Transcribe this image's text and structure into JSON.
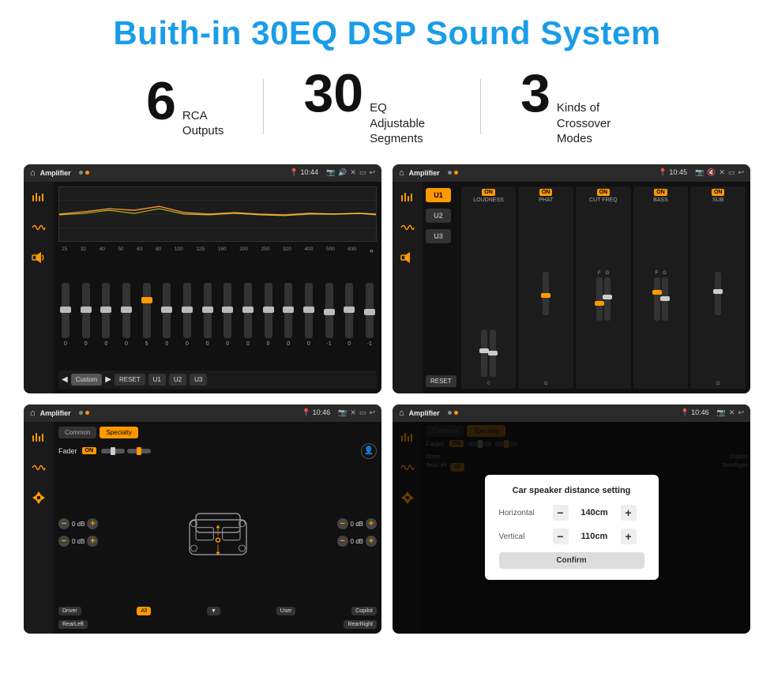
{
  "title": "Buith-in 30EQ DSP Sound System",
  "stats": [
    {
      "number": "6",
      "desc_line1": "RCA",
      "desc_line2": "Outputs"
    },
    {
      "number": "30",
      "desc_line1": "EQ Adjustable",
      "desc_line2": "Segments"
    },
    {
      "number": "3",
      "desc_line1": "Kinds of",
      "desc_line2": "Crossover Modes"
    }
  ],
  "screens": [
    {
      "id": "eq-screen",
      "topbar": {
        "title": "Amplifier",
        "time": "10:44"
      },
      "type": "eq"
    },
    {
      "id": "crossover-screen",
      "topbar": {
        "title": "Amplifier",
        "time": "10:45"
      },
      "type": "crossover"
    },
    {
      "id": "fader-screen",
      "topbar": {
        "title": "Amplifier",
        "time": "10:46"
      },
      "type": "fader"
    },
    {
      "id": "dialog-screen",
      "topbar": {
        "title": "Amplifier",
        "time": "10:46"
      },
      "type": "dialog",
      "dialog": {
        "title": "Car speaker distance setting",
        "horizontal_label": "Horizontal",
        "horizontal_value": "140cm",
        "vertical_label": "Vertical",
        "vertical_value": "110cm",
        "confirm_label": "Confirm"
      }
    }
  ],
  "eq": {
    "freq_labels": [
      "25",
      "32",
      "40",
      "50",
      "63",
      "80",
      "100",
      "125",
      "160",
      "200",
      "250",
      "320",
      "400",
      "500",
      "630"
    ],
    "values": [
      "0",
      "0",
      "0",
      "0",
      "5",
      "0",
      "0",
      "0",
      "0",
      "0",
      "0",
      "0",
      "0",
      "-1",
      "0",
      "-1"
    ],
    "buttons": [
      "Custom",
      "RESET",
      "U1",
      "U2",
      "U3"
    ]
  },
  "crossover": {
    "u_buttons": [
      "U1",
      "U2",
      "U3"
    ],
    "reset": "RESET",
    "channels": [
      "LOUDNESS",
      "PHAT",
      "CUT FREQ",
      "BASS",
      "SUB"
    ],
    "on_labels": [
      "ON",
      "ON",
      "ON",
      "ON",
      "ON"
    ]
  },
  "fader": {
    "tabs": [
      "Common",
      "Specialty"
    ],
    "fader_label": "Fader",
    "on_label": "ON",
    "bottom_labels": [
      "Driver",
      "RearLeft",
      "All",
      "User",
      "Copilot",
      "RearRight"
    ]
  },
  "dialog": {
    "title": "Car speaker distance setting",
    "horizontal_label": "Horizontal",
    "horizontal_value": "140cm",
    "vertical_label": "Vertical",
    "vertical_value": "110cm",
    "confirm_label": "Confirm"
  }
}
